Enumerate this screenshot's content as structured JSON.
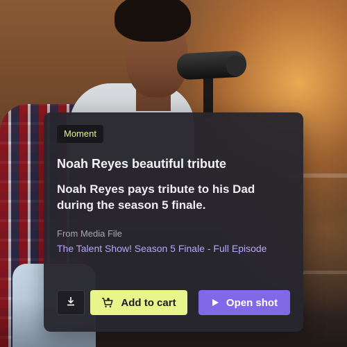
{
  "colors": {
    "card_bg": "#28272E",
    "tag_text": "#E7F58A",
    "cart_button": "#E7F58A",
    "open_button": "#7F69E6",
    "link": "#B6A6FF"
  },
  "card": {
    "tag": "Moment",
    "title": "Noah Reyes beautiful tribute",
    "description": "Noah Reyes pays tribute to his Dad during the season 5 finale.",
    "source_label": "From Media File",
    "source_link": "The Talent Show! Season 5 Finale - Full Episode"
  },
  "actions": {
    "download_icon": "download-icon",
    "cart_icon": "cart-add-icon",
    "add_to_cart_label": "Add to cart",
    "play_icon": "play-icon",
    "open_shot_label": "Open shot"
  }
}
